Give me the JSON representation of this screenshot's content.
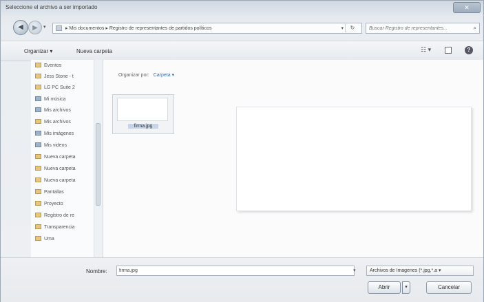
{
  "window": {
    "title": "Seleccione el archivo a ser importado",
    "close_glyph": "✕"
  },
  "nav": {
    "back_glyph": "◀",
    "forward_glyph": "▶",
    "recent_glyph": "▾"
  },
  "address": {
    "crumbs": "▸ Mis documentos ▸ Registro de representantes de partidos políticos",
    "dropdown_glyph": "▾",
    "refresh_glyph": "↻"
  },
  "search": {
    "placeholder": "Buscar Registro de representantes...",
    "icon": "search-icon"
  },
  "toolbar": {
    "organize_label": "Organizar ▾",
    "new_folder_label": "Nueva carpeta",
    "views_glyph": "☷ ▾",
    "help_glyph": "?"
  },
  "sidebar": {
    "items": [
      {
        "label": "Eventos",
        "icon": "folder"
      },
      {
        "label": "Jess Stone - t",
        "icon": "folder"
      },
      {
        "label": "LG PC Suite 2",
        "icon": "folder"
      },
      {
        "label": "Mi música",
        "icon": "library"
      },
      {
        "label": "Mis archivos",
        "icon": "library"
      },
      {
        "label": "Mis archivos",
        "icon": "folder"
      },
      {
        "label": "Mis imágenes",
        "icon": "library"
      },
      {
        "label": "Mis videos",
        "icon": "library"
      },
      {
        "label": "Nueva carpeta",
        "icon": "folder"
      },
      {
        "label": "Nueva carpeta",
        "icon": "folder"
      },
      {
        "label": "Nueva carpeta",
        "icon": "folder"
      },
      {
        "label": "Pantallas",
        "icon": "folder"
      },
      {
        "label": "Proyecto",
        "icon": "folder"
      },
      {
        "label": "Registro de re",
        "icon": "folder"
      },
      {
        "label": "Transparencia",
        "icon": "folder"
      },
      {
        "label": "Uma",
        "icon": "folder"
      }
    ]
  },
  "content": {
    "arrange_label": "Organizar por:",
    "arrange_value": "Carpeta ▾",
    "files": [
      {
        "name": "firma.jpg"
      }
    ]
  },
  "footer": {
    "filename_label": "Nombre:",
    "filename_value": "firma.jpg",
    "filename_dropdown_glyph": "▾",
    "filter_value": "Archivos de Imagenes (*.jpg,*.a ▾",
    "open_label": "Abrir",
    "open_split_glyph": "▾",
    "cancel_label": "Cancelar"
  }
}
